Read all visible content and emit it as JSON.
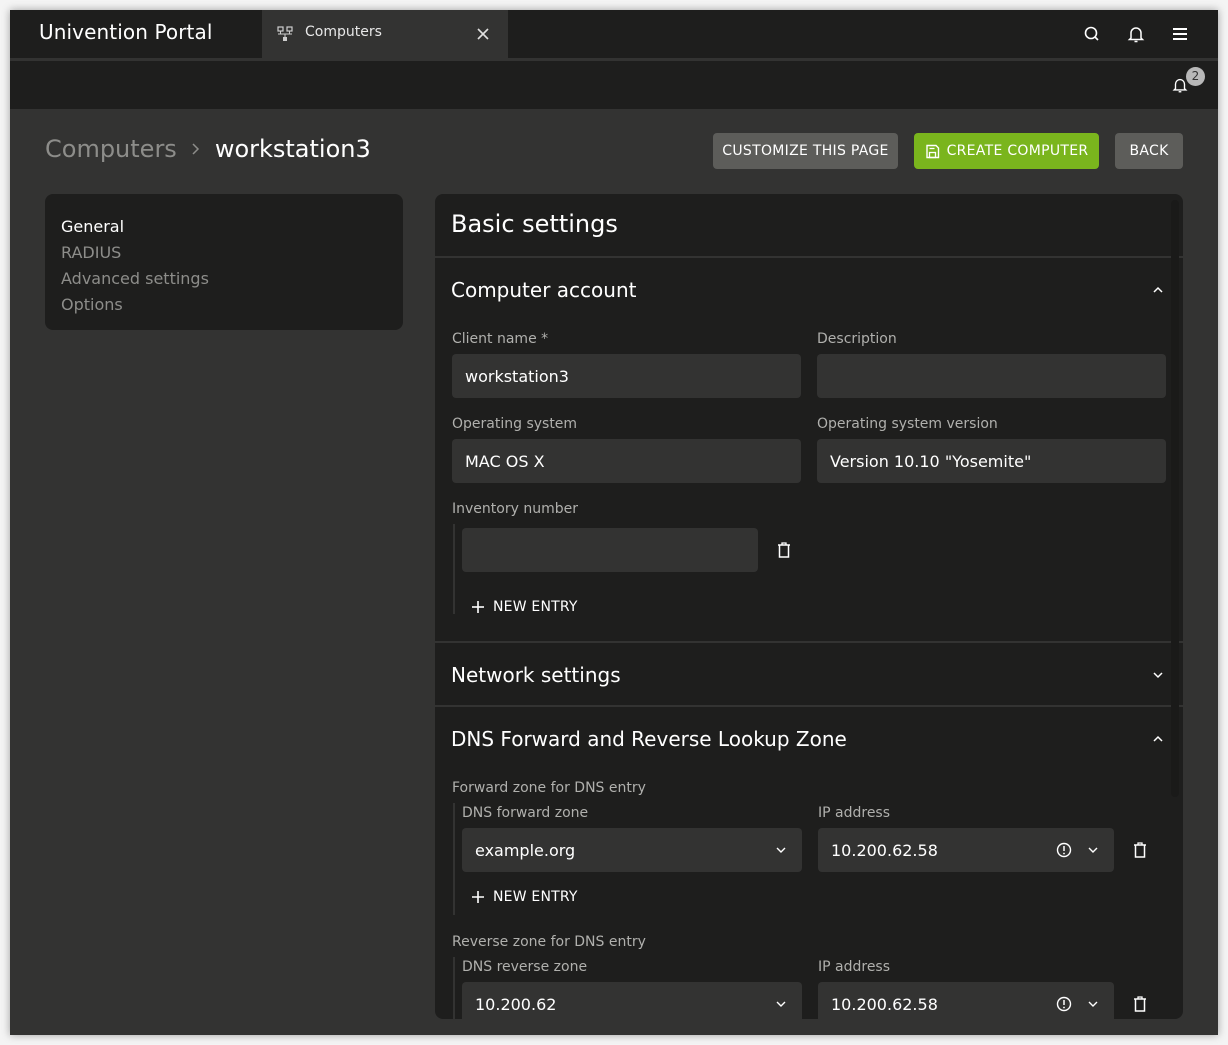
{
  "app": {
    "title": "Univention Portal",
    "tab": {
      "label": "Computers",
      "icon": "computers-network-icon"
    },
    "header_icons": [
      "search-icon",
      "bell-icon",
      "menu-icon"
    ],
    "notifications": {
      "count": "2"
    }
  },
  "breadcrumb": {
    "parent": "Computers",
    "current": "workstation3"
  },
  "toolbar": {
    "customize_label": "CUSTOMIZE THIS PAGE",
    "create_label": "CREATE COMPUTER",
    "back_label": "BACK"
  },
  "colors": {
    "accent": "#7ab51d",
    "background": "#333332",
    "panel": "#1e1e1d"
  },
  "sidebar": {
    "items": [
      {
        "label": "General",
        "active": true
      },
      {
        "label": "RADIUS",
        "active": false
      },
      {
        "label": "Advanced settings",
        "active": false
      },
      {
        "label": "Options",
        "active": false
      }
    ]
  },
  "main": {
    "title": "Basic settings",
    "sections": {
      "computer_account": {
        "title": "Computer account",
        "expanded": true,
        "client_name": {
          "label": "Client name *",
          "value": "workstation3"
        },
        "description": {
          "label": "Description",
          "value": ""
        },
        "os": {
          "label": "Operating system",
          "value": "MAC OS X"
        },
        "os_version": {
          "label": "Operating system version",
          "value": "Version 10.10 \"Yosemite\""
        },
        "inventory": {
          "label": "Inventory number",
          "entries": [
            ""
          ],
          "new_entry_label": "NEW ENTRY"
        }
      },
      "network": {
        "title": "Network settings",
        "expanded": false
      },
      "dns": {
        "title": "DNS Forward and Reverse Lookup Zone",
        "expanded": true,
        "forward": {
          "label": "Forward zone for DNS entry",
          "zone_label": "DNS forward zone",
          "ip_label": "IP address",
          "entries": [
            {
              "zone": "example.org",
              "ip": "10.200.62.58"
            }
          ],
          "new_entry_label": "NEW ENTRY"
        },
        "reverse": {
          "label": "Reverse zone for DNS entry",
          "zone_label": "DNS reverse zone",
          "ip_label": "IP address",
          "entries": [
            {
              "zone": "10.200.62",
              "ip": "10.200.62.58"
            }
          ]
        }
      }
    }
  }
}
